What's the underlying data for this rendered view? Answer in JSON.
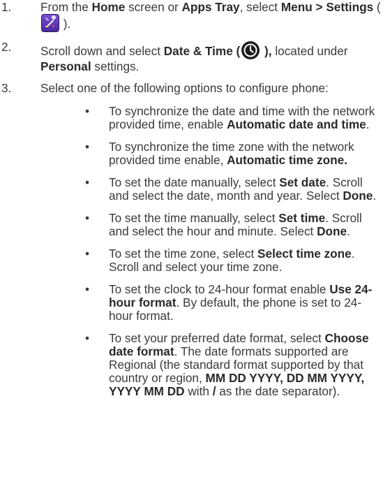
{
  "steps": [
    {
      "number": "1.",
      "parts": [
        "From the ",
        "Home",
        " screen or ",
        "Apps Tray",
        ", select ",
        "Menu > Settings",
        " ( ",
        " )."
      ],
      "icon": "settings-icon"
    },
    {
      "number": "2.",
      "parts": [
        "Scroll down and select ",
        "Date & Time (",
        " ),",
        " located under ",
        "Personal",
        " settings."
      ],
      "icon": "clock-icon"
    },
    {
      "number": "3.",
      "text": "Select one of the following options to configure phone:"
    }
  ],
  "bullet_glyph": "•",
  "bullets": [
    [
      "To synchronize the date and time with the network provided time, enable ",
      "Automatic date and time",
      "."
    ],
    [
      "To synchronize the time zone with the network provided time enable, ",
      "Automatic time zone."
    ],
    [
      "To set the date manually, select ",
      "Set date",
      ". Scroll and select the date, month and year. Select ",
      "Done",
      "."
    ],
    [
      "To set the time manually, select ",
      "Set time",
      ". Scroll and select the hour and minute. Select ",
      "Done",
      "."
    ],
    [
      "To set the time zone, select ",
      "Select time zone",
      ". Scroll and select your time zone."
    ],
    [
      "To set the clock to 24-hour format enable ",
      "Use 24-hour format",
      ". By default, the phone is set to 24-hour format."
    ],
    [
      "To set your preferred date format, select ",
      "Choose date format",
      ". The date formats supported are Regional (the standard format supported by that country or region, ",
      "MM DD YYYY, DD MM YYYY, YYYY MM DD",
      " with ",
      "/",
      " as the date separator)."
    ]
  ]
}
